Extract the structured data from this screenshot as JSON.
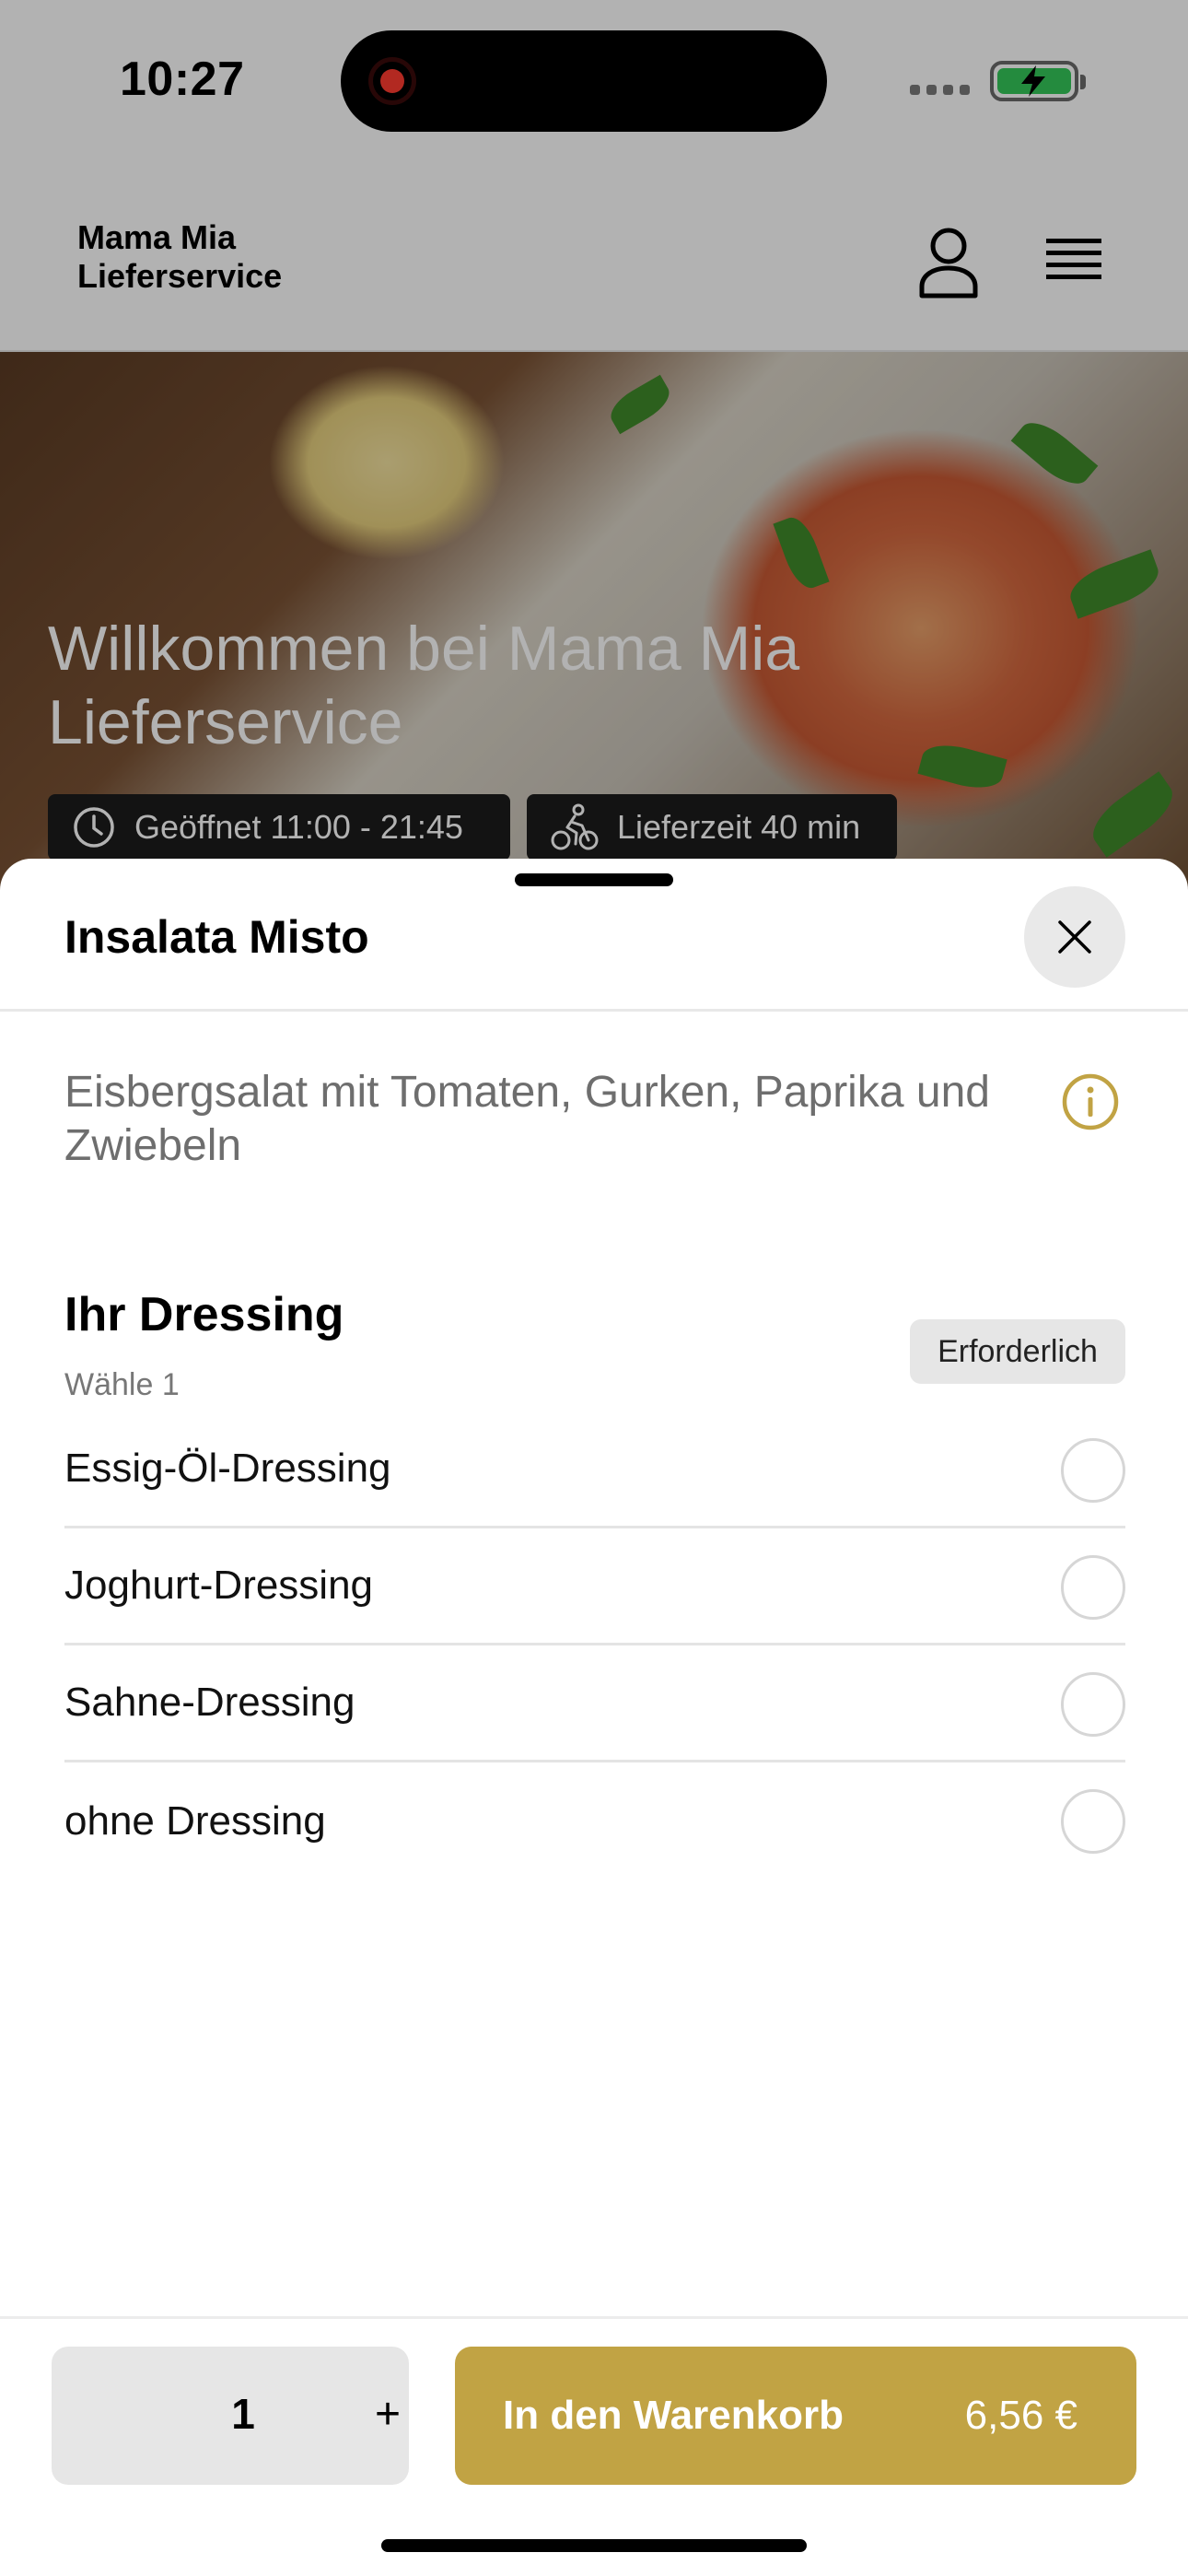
{
  "status_bar": {
    "time": "10:27"
  },
  "header": {
    "brand_line1": "Mama Mia",
    "brand_line2": "Lieferservice"
  },
  "hero": {
    "title_line1": "Willkommen bei Mama Mia",
    "title_line2": "Lieferservice",
    "opening_hours": "Geöffnet 11:00 - 21:45",
    "delivery_time": "Lieferzeit 40 min"
  },
  "sheet": {
    "title": "Insalata Misto",
    "description": "Eisbergsalat mit Tomaten, Gurken, Paprika und Zwiebeln",
    "group": {
      "title": "Ihr Dressing",
      "subtitle": "Wähle 1",
      "badge": "Erforderlich",
      "options": [
        {
          "label": "Essig-Öl-Dressing",
          "selected": false
        },
        {
          "label": "Joghurt-Dressing",
          "selected": false
        },
        {
          "label": "Sahne-Dressing",
          "selected": false
        },
        {
          "label": "ohne Dressing",
          "selected": false
        }
      ]
    }
  },
  "cart_bar": {
    "quantity": "1",
    "plus_label": "+",
    "add_label": "In den Warenkorb",
    "price": "6,56 €"
  },
  "colors": {
    "accent": "#c1a344",
    "recording": "#ff3b30",
    "battery": "#34c759"
  }
}
